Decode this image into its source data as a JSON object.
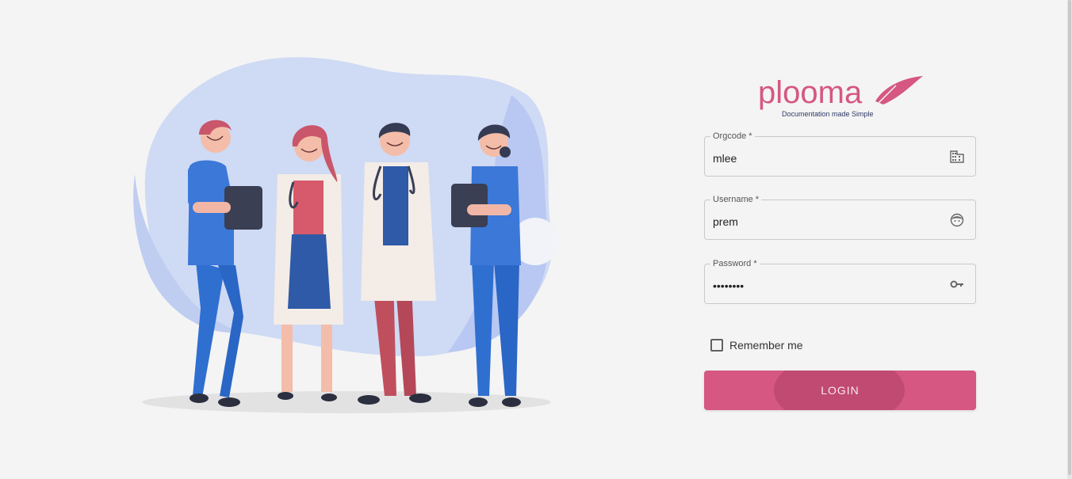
{
  "brand": {
    "name": "plooma",
    "tagline": "Documentation made Simple",
    "color": "#d55782"
  },
  "form": {
    "orgcode": {
      "label": "Orgcode *",
      "value": "mlee",
      "icon": "building-icon"
    },
    "username": {
      "label": "Username *",
      "value": "prem",
      "icon": "face-icon"
    },
    "password": {
      "label": "Password *",
      "value": "••••••••",
      "icon": "key-icon"
    },
    "remember_label": "Remember me",
    "remember_checked": false,
    "login_label": "LOGIN"
  },
  "colors": {
    "background": "#f4f4f4",
    "button": "#d55782",
    "field_border": "#c9c9c9"
  }
}
